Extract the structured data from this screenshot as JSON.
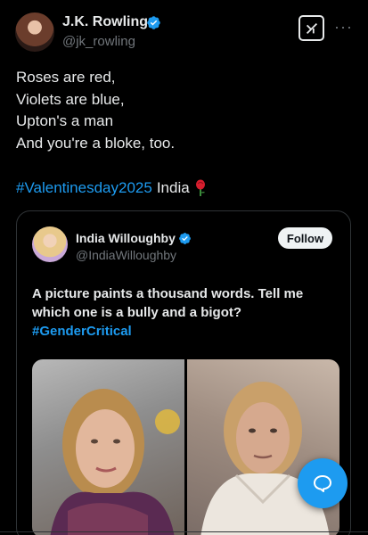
{
  "post": {
    "author_name": "J.K. Rowling",
    "author_handle": "@jk_rowling",
    "poem_lines": [
      "Roses are red,",
      "Violets are blue,",
      "Upton's a man",
      "And you're a bloke, too."
    ],
    "hashtag": "#Valentinesday2025",
    "tag_text": "India",
    "icons": {
      "verified": "verified-badge-icon",
      "grok": "grok-icon",
      "more": "more-icon",
      "rose": "rose-emoji-icon",
      "reply": "reply-fab-icon"
    }
  },
  "quoted_post": {
    "author_name": "India Willoughby",
    "author_handle": "@IndiaWilloughby",
    "follow_label": "Follow",
    "text": "A picture paints a thousand words. Tell me which one is a bully and a bigot?",
    "hashtag": "#GenderCritical"
  },
  "colors": {
    "background": "#000000",
    "text": "#e7e9ea",
    "secondary": "#71767b",
    "accent": "#1d9bf0"
  }
}
